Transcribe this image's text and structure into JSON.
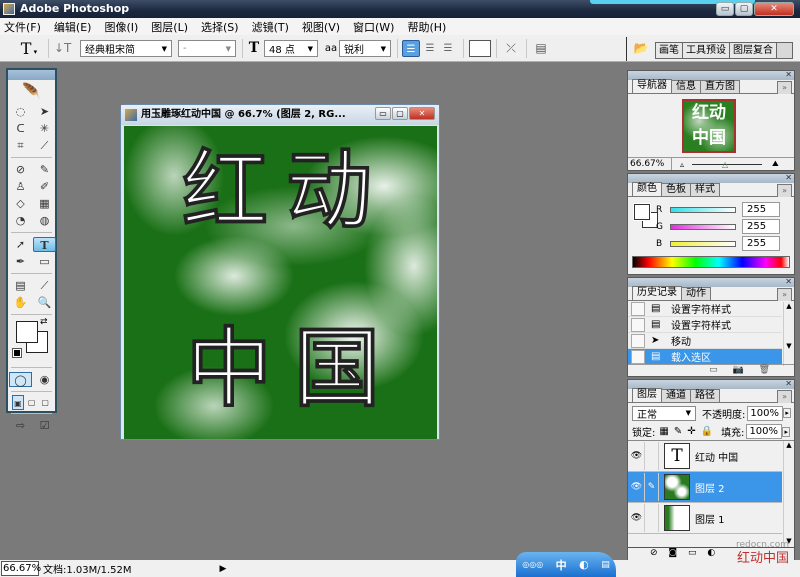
{
  "window": {
    "title": "Adobe Photoshop",
    "min": "▭",
    "max": "▢",
    "close": "✕"
  },
  "menu": [
    "文件(F)",
    "编辑(E)",
    "图像(I)",
    "图层(L)",
    "选择(S)",
    "滤镜(T)",
    "视图(V)",
    "窗口(W)",
    "帮助(H)"
  ],
  "options": {
    "tool_glyph": "T",
    "orient_glyph": "↓T",
    "font_family": "经典粗宋简",
    "font_style": "-",
    "size_glyph": "T",
    "font_size": "48 点",
    "aa_glyph": "aa",
    "antialias": "锐利",
    "align": [
      "left",
      "center",
      "right"
    ],
    "color_swatch": "#ffffff",
    "warp_glyph": "⤫",
    "palette_glyph": "▤"
  },
  "well_tabs": [
    "画笔",
    "工具预设",
    "图层复合"
  ],
  "toolbox": {
    "tools": [
      "marquee",
      "move",
      "lasso",
      "magic-wand",
      "crop",
      "slice",
      "healing",
      "brush",
      "stamp",
      "history-brush",
      "eraser",
      "gradient",
      "blur",
      "dodge",
      "path-select",
      "type",
      "pen",
      "shape",
      "notes",
      "eyedropper",
      "hand",
      "zoom"
    ],
    "glyphs": [
      "◌",
      "➤",
      "ᑕ",
      "✳",
      "⌗",
      "⟋",
      "⊘",
      "✎",
      "♙",
      "✐",
      "◇",
      "▦",
      "◔",
      "◍",
      "➚",
      "T",
      "✒",
      "▭",
      "▤",
      "⟋",
      "✋",
      "🔍"
    ],
    "active_tool": "type",
    "foreground": "#ffffff",
    "background": "#ffffff"
  },
  "document": {
    "title": "用玉雕琢红动中国 @ 66.7% (图层 2, RG...",
    "canvas_text": [
      "红",
      "动",
      "中",
      "国"
    ],
    "colors": {
      "green": "#1a7016",
      "white": "#ffffff"
    }
  },
  "navigator": {
    "tabs": [
      "导航器",
      "信息",
      "直方图"
    ],
    "zoom": "66.67%",
    "thumb_text": [
      "红动",
      "中国"
    ]
  },
  "color_panel": {
    "tabs": [
      "颜色",
      "色板",
      "样式"
    ],
    "channels": [
      {
        "label": "R",
        "value": "255",
        "color": "#30e0e8"
      },
      {
        "label": "G",
        "value": "255",
        "color": "#e030e0"
      },
      {
        "label": "B",
        "value": "255",
        "color": "#f0f030"
      }
    ]
  },
  "history": {
    "tabs": [
      "历史记录",
      "动作"
    ],
    "items": [
      {
        "label": "设置字符样式",
        "selected": false
      },
      {
        "label": "设置字符样式",
        "selected": false
      },
      {
        "label": "移动",
        "selected": false
      },
      {
        "label": "载入选区",
        "selected": true
      }
    ]
  },
  "layers": {
    "tabs": [
      "图层",
      "通道",
      "路径"
    ],
    "blend_mode": "正常",
    "opacity_label": "不透明度:",
    "opacity": "100%",
    "lock_label": "锁定:",
    "fill_label": "填充:",
    "fill": "100%",
    "items": [
      {
        "name": "红动 中国",
        "type": "text",
        "thumb": "T",
        "visible": true,
        "active": false
      },
      {
        "name": "图层 2",
        "type": "image",
        "thumb": "",
        "visible": true,
        "active": true
      },
      {
        "name": "图层 1",
        "type": "image",
        "thumb": "",
        "visible": true,
        "active": false
      }
    ]
  },
  "status": {
    "zoom": "66.67%",
    "doc": "文档:1.03M/1.52M",
    "arrow": "▶"
  },
  "ime": {
    "label": "中"
  },
  "watermark": {
    "url": "redocn.com",
    "text": "红动中国"
  }
}
